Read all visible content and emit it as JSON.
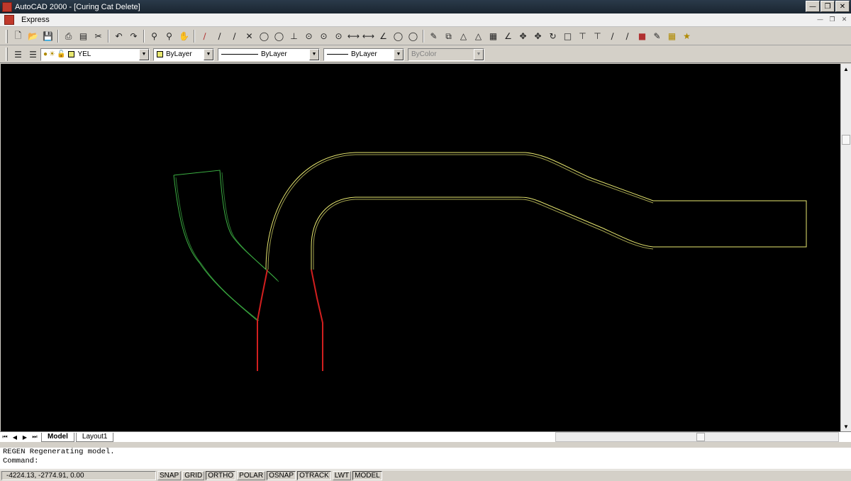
{
  "window": {
    "title": "AutoCAD 2000 - [Curing Cat Delete]"
  },
  "menubar": {
    "items": [
      {
        "label": "Express"
      }
    ]
  },
  "toolbar2": {
    "layer_value": "YEL",
    "color_value": "ByLayer",
    "linetype_value": "ByLayer",
    "lineweight_value": "ByLayer",
    "plotstyle_value": "ByColor"
  },
  "tabs": [
    {
      "label": "Model"
    },
    {
      "label": "Layout1"
    }
  ],
  "command": {
    "history": "REGEN  Regenerating model.",
    "prompt": "Command:"
  },
  "status": {
    "coords": "-4224.13, -2774.91, 0.00",
    "buttons": [
      "SNAP",
      "GRID",
      "ORTHO",
      "POLAR",
      "OSNAP",
      "OTRACK",
      "LWT",
      "MODEL"
    ]
  },
  "colors": {
    "yellow": "#e8e870",
    "green": "#3cb043",
    "red": "#d21f1f",
    "canvas": "#000000"
  }
}
